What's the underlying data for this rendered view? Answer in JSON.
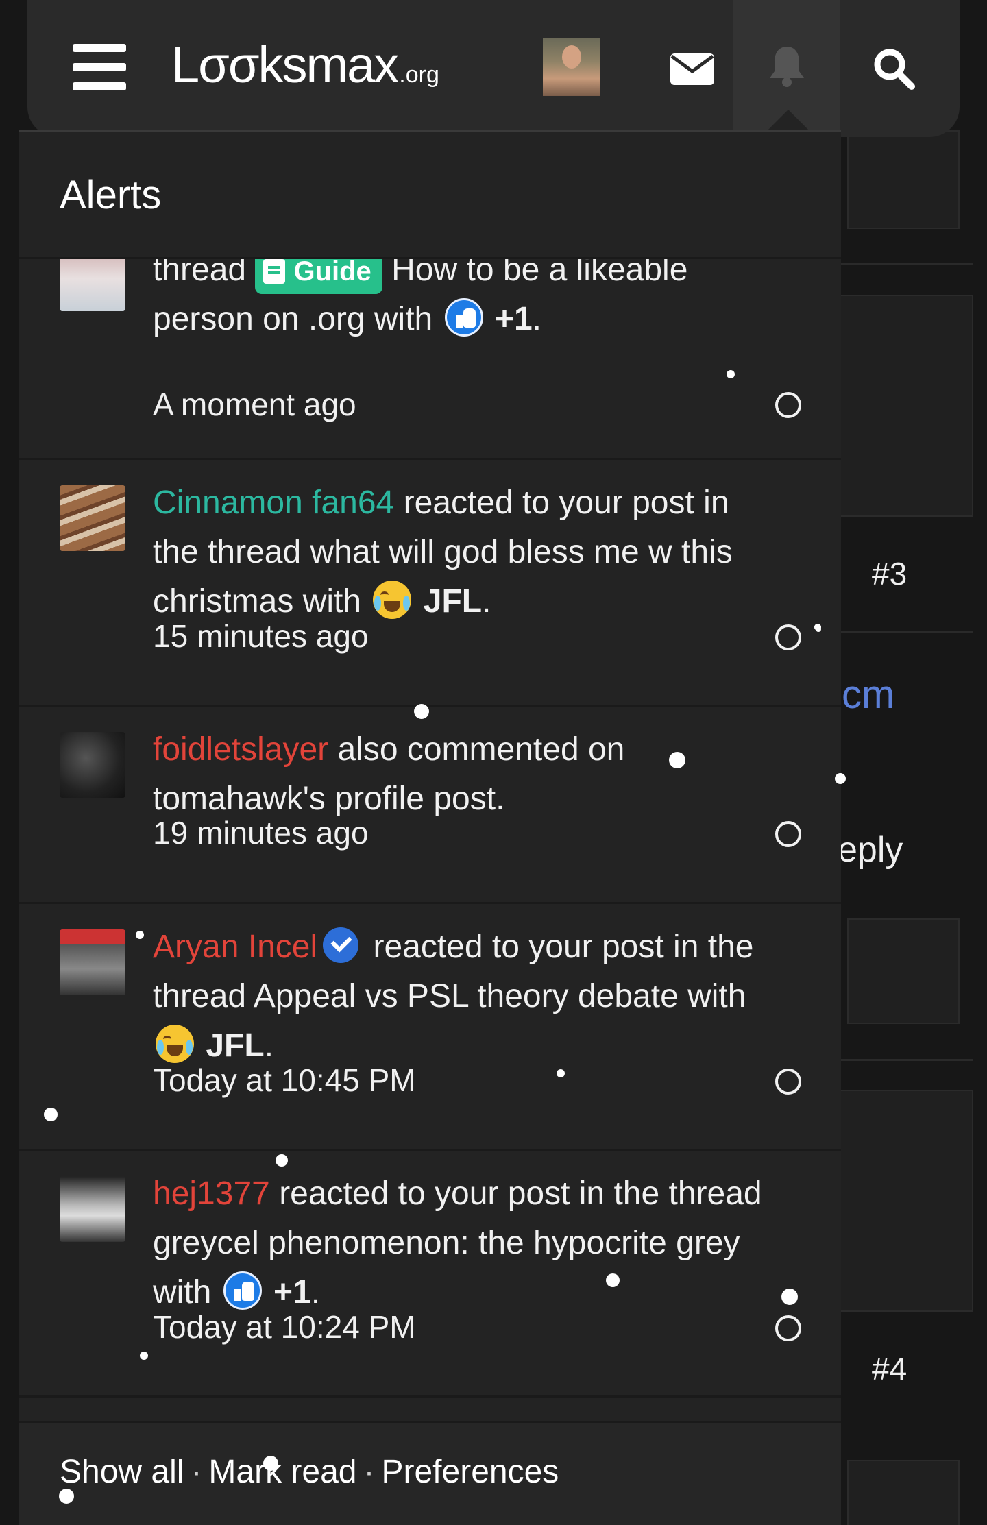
{
  "header": {
    "logo_main": "Lσσksmax",
    "logo_suffix": ".org",
    "icons": [
      "menu-icon",
      "envelope-icon",
      "bell-icon",
      "search-icon"
    ]
  },
  "background_page": {
    "post_number_1": "#3",
    "post_number_2": "#4",
    "link_fragment": "cm",
    "reply_fragment": "eply"
  },
  "alerts_popup": {
    "title": "Alerts",
    "items": [
      {
        "pre": "thread",
        "prefix_badge": "Guide",
        "thread_title": "How to be a likeable person on .org",
        "with": "with",
        "reaction": "+1",
        "reaction_icon": "like-icon",
        "time": "A moment ago"
      },
      {
        "user": "Cinnamon fan64",
        "action": "reacted to your post in the thread what will god bless me w this christmas with",
        "reaction": "JFL",
        "reaction_icon": "jfl-icon",
        "time": "15 minutes ago"
      },
      {
        "user": "foidletslayer",
        "action": "also commented on tomahawk's profile post.",
        "time": "19 minutes ago"
      },
      {
        "user": "Aryan Incel",
        "action": "reacted to your post in the thread Appeal vs PSL theory debate with",
        "reaction": "JFL",
        "reaction_icon": "jfl-icon",
        "time": "Today at 10:45 PM"
      },
      {
        "user": "hej1377",
        "action": "reacted to your post in the thread greycel phenomenon: the hypocrite grey with",
        "reaction": "+1",
        "reaction_icon": "like-icon",
        "time": "Today at 10:24 PM"
      }
    ],
    "footer": {
      "show_all": "Show all",
      "mark_read": "Mark read",
      "preferences": "Preferences",
      "separator": "·"
    }
  },
  "colors": {
    "accent_teal": "#2cb8a0",
    "username_red": "#e2443a",
    "guide_green": "#27c08b",
    "popup_bg": "#232323"
  }
}
